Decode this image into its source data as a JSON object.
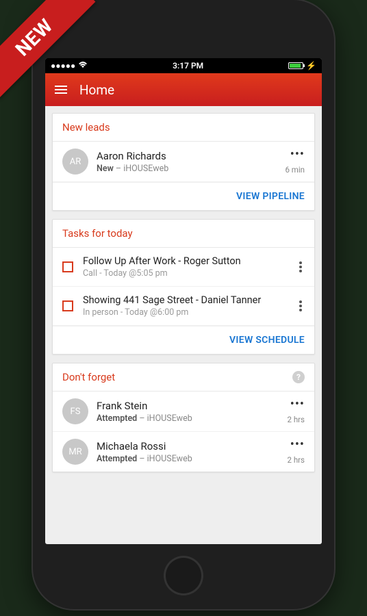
{
  "ribbon": "NEW",
  "statusbar": {
    "time": "3:17 PM"
  },
  "header": {
    "title": "Home"
  },
  "new_leads": {
    "title": "New leads",
    "action": "VIEW PIPELINE",
    "items": [
      {
        "initials": "AR",
        "name": "Aaron Richards",
        "status": "New",
        "source": "iHOUSEweb",
        "time": "6 min"
      }
    ]
  },
  "tasks": {
    "title": "Tasks for today",
    "action": "VIEW SCHEDULE",
    "items": [
      {
        "title": "Follow Up After Work - Roger Sutton",
        "sub": "Call - Today @5:05 pm"
      },
      {
        "title": "Showing 441 Sage Street - Daniel Tanner",
        "sub": "In person - Today @6:00 pm"
      }
    ]
  },
  "dont_forget": {
    "title": "Don't forget",
    "items": [
      {
        "initials": "FS",
        "name": "Frank Stein",
        "status": "Attempted",
        "source": "iHOUSEweb",
        "time": "2 hrs"
      },
      {
        "initials": "MR",
        "name": "Michaela Rossi",
        "status": "Attempted",
        "source": "iHOUSEweb",
        "time": "2 hrs"
      }
    ]
  }
}
